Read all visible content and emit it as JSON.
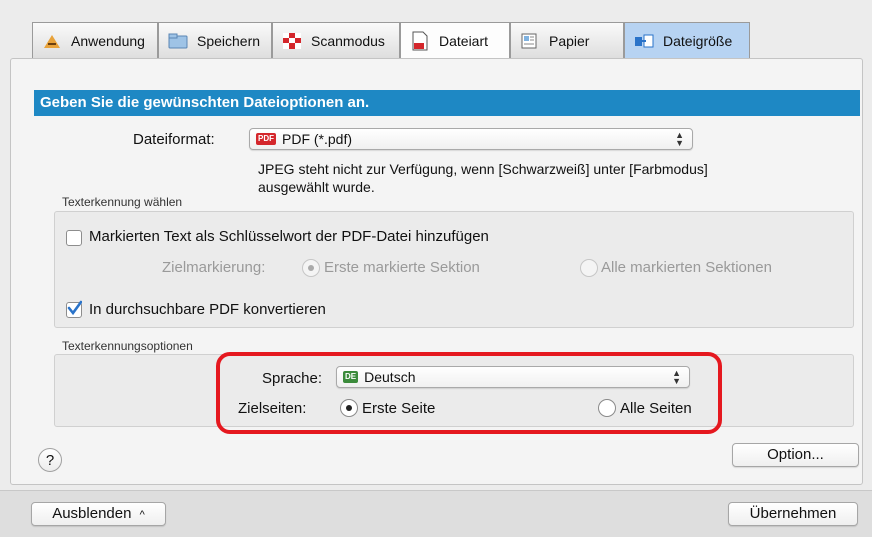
{
  "tabs": [
    {
      "label": "Anwendung",
      "icon": "application-icon"
    },
    {
      "label": "Speichern",
      "icon": "folder-icon"
    },
    {
      "label": "Scanmodus",
      "icon": "scanmode-icon"
    },
    {
      "label": "Dateiart",
      "icon": "filetype-icon"
    },
    {
      "label": "Papier",
      "icon": "paper-icon"
    },
    {
      "label": "Dateigröße",
      "icon": "filesize-icon"
    }
  ],
  "header": "Geben Sie die gewünschten Dateioptionen an.",
  "fileformat": {
    "label": "Dateiformat:",
    "badge": "PDF",
    "value": "PDF (*.pdf)",
    "note_line1": "JPEG steht nicht zur Verfügung, wenn [Schwarzweiß] unter [Farbmodus]",
    "note_line2": "ausgewählt wurde."
  },
  "text_recognition": {
    "group_label": "Texterkennung wählen",
    "keyword_checkbox": "Markierten Text als Schlüsselwort der PDF-Datei hinzufügen",
    "target_label": "Zielmarkierung:",
    "option_first": "Erste markierte Sektion",
    "option_all": "Alle markierten Sektionen",
    "searchable_checkbox": "In durchsuchbare PDF konvertieren"
  },
  "ocr_options": {
    "group_label": "Texterkennungsoptionen",
    "language_label": "Sprache:",
    "language_badge": "DE",
    "language_value": "Deutsch",
    "pages_label": "Zielseiten:",
    "pages_first": "Erste Seite",
    "pages_all": "Alle Seiten"
  },
  "buttons": {
    "help": "?",
    "option": "Option...",
    "hide": "Ausblenden",
    "apply": "Übernehmen"
  },
  "colors": {
    "header_blue": "#1e88c4",
    "highlight_red": "#e5181f",
    "check_blue": "#2a73c9"
  }
}
